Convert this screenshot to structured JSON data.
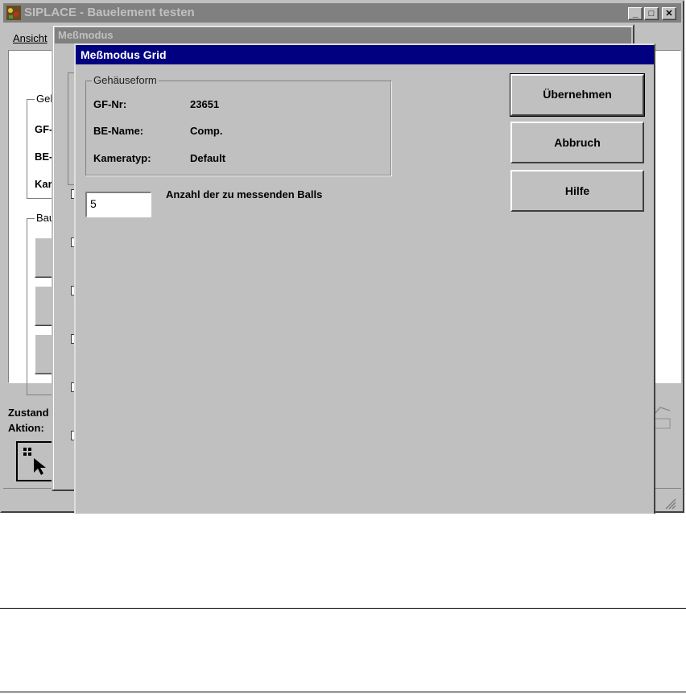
{
  "main_window": {
    "title": "SIPLACE - Bauelement testen",
    "menu_ansicht": "Ansicht",
    "group_gehaeuse_partial": "Geh",
    "label_gf_partial": "GF-",
    "label_be_partial": "BE-",
    "label_kam_partial": "Kar",
    "group_bau_partial": "Bau",
    "status_zustand": "Zustand",
    "status_aktion": "Aktion:",
    "minimize": "_",
    "maximize": "□",
    "close": "✕"
  },
  "messmodus_window": {
    "title": "Meßmodus"
  },
  "grid_dialog": {
    "title": "Meßmodus Grid",
    "group_title": "Gehäuseform",
    "gf_label": "GF-Nr:",
    "gf_value": "23651",
    "be_label": "BE-Name:",
    "be_value": "Comp.",
    "kamera_label": "Kameratyp:",
    "kamera_value": "Default",
    "balls_value": "5",
    "balls_label": "Anzahl der zu messenden Balls",
    "btn_ok": "Übernehmen",
    "btn_cancel": "Abbruch",
    "btn_help": "Hilfe"
  }
}
